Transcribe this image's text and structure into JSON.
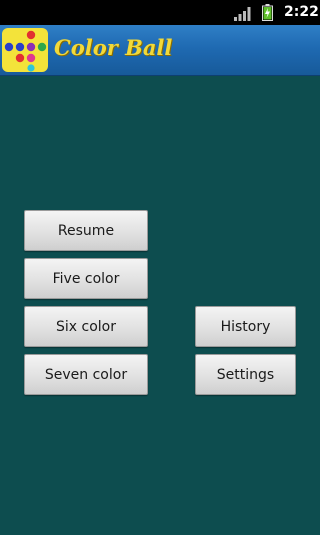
{
  "status_bar": {
    "time": "2:22",
    "signal_icon": "signal-bars-icon",
    "battery_icon": "battery-charging-icon"
  },
  "app": {
    "title": "Color Ball",
    "icon": "color-balls-logo-icon"
  },
  "menu": {
    "resume": "Resume",
    "five_color": "Five color",
    "six_color": "Six color",
    "seven_color": "Seven color",
    "history": "History",
    "settings": "Settings"
  },
  "colors": {
    "background": "#0d4d4f",
    "title_bar": "#1f6ab2",
    "title_text": "#f2d93a"
  }
}
